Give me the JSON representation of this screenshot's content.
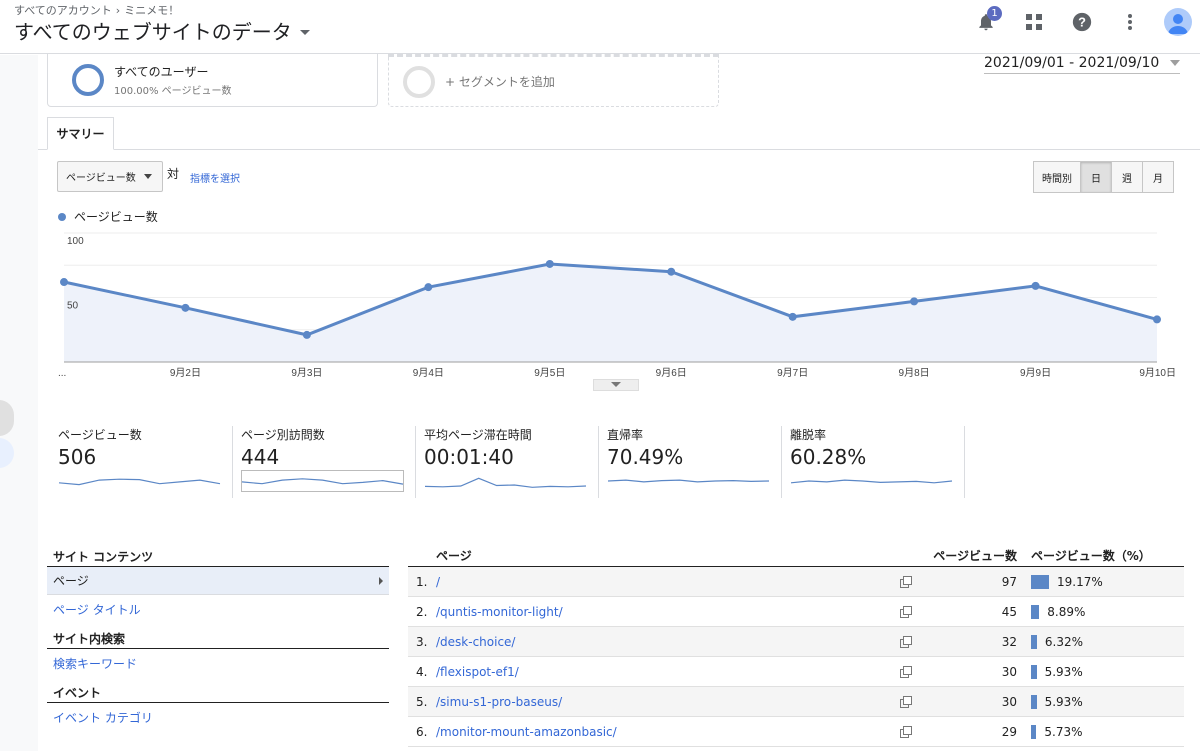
{
  "header": {
    "breadcrumb": [
      "すべてのアカウント",
      "ミニメモ！"
    ],
    "title": "すべてのウェブサイトのデータ",
    "notification_count": "1"
  },
  "segments": {
    "active_name": "すべてのユーザー",
    "active_sub": "100.00% ページビュー数",
    "add_label": "+ セグメントを追加"
  },
  "date_range": "2021/09/01 - 2021/09/10",
  "tabs": [
    "サマリー"
  ],
  "controls": {
    "metric_select": "ページビュー数",
    "vs": "対",
    "pick_metric": "指標を選択",
    "periods": [
      "時間別",
      "日",
      "週",
      "月"
    ],
    "active_period": "日"
  },
  "chart_data": {
    "type": "area",
    "legend": "ページビュー数",
    "x": [
      "...",
      "9月2日",
      "9月3日",
      "9月4日",
      "9月5日",
      "9月6日",
      "9月7日",
      "9月8日",
      "9月9日",
      "9月10日"
    ],
    "values": [
      62,
      42,
      21,
      58,
      76,
      70,
      35,
      47,
      59,
      33
    ],
    "ylim": [
      0,
      100
    ],
    "yticks": [
      "100",
      "50"
    ],
    "color": "#5b87c6",
    "fill": "#eef2fa"
  },
  "scorecards": [
    {
      "label": "ページビュー数",
      "value": "506",
      "spark": [
        40,
        30,
        55,
        60,
        58,
        35,
        45,
        55,
        35
      ]
    },
    {
      "label": "ページ別訪問数",
      "value": "444",
      "spark": [
        45,
        35,
        55,
        62,
        55,
        35,
        42,
        52,
        33
      ]
    },
    {
      "label": "平均ページ滞在時間",
      "value": "00:01:40",
      "spark": [
        20,
        18,
        22,
        65,
        25,
        28,
        15,
        20,
        18,
        22
      ]
    },
    {
      "label": "直帰率",
      "value": "70.49%",
      "spark": [
        50,
        55,
        45,
        52,
        55,
        45,
        50,
        52,
        48,
        50
      ]
    },
    {
      "label": "離脱率",
      "value": "60.28%",
      "spark": [
        40,
        50,
        45,
        55,
        50,
        42,
        45,
        48,
        40,
        50
      ]
    }
  ],
  "nav": {
    "h1": "サイト コンテンツ",
    "items1": [
      "ページ",
      "ページ タイトル"
    ],
    "h2": "サイト内検索",
    "items2": [
      "検索キーワード"
    ],
    "h3": "イベント",
    "items3": [
      "イベント カテゴリ"
    ]
  },
  "table": {
    "headers": [
      "ページ",
      "ページビュー数",
      "ページビュー数（%）"
    ],
    "rows": [
      {
        "idx": "1.",
        "page": "/",
        "pv": "97",
        "pct": "19.17%",
        "pct_val": 19.17
      },
      {
        "idx": "2.",
        "page": "/quntis-monitor-light/",
        "pv": "45",
        "pct": "8.89%",
        "pct_val": 8.89
      },
      {
        "idx": "3.",
        "page": "/desk-choice/",
        "pv": "32",
        "pct": "6.32%",
        "pct_val": 6.32
      },
      {
        "idx": "4.",
        "page": "/flexispot-ef1/",
        "pv": "30",
        "pct": "5.93%",
        "pct_val": 5.93
      },
      {
        "idx": "5.",
        "page": "/simu-s1-pro-baseus/",
        "pv": "30",
        "pct": "5.93%",
        "pct_val": 5.93
      },
      {
        "idx": "6.",
        "page": "/monitor-mount-amazonbasic/",
        "pv": "29",
        "pct": "5.73%",
        "pct_val": 5.73
      }
    ]
  }
}
